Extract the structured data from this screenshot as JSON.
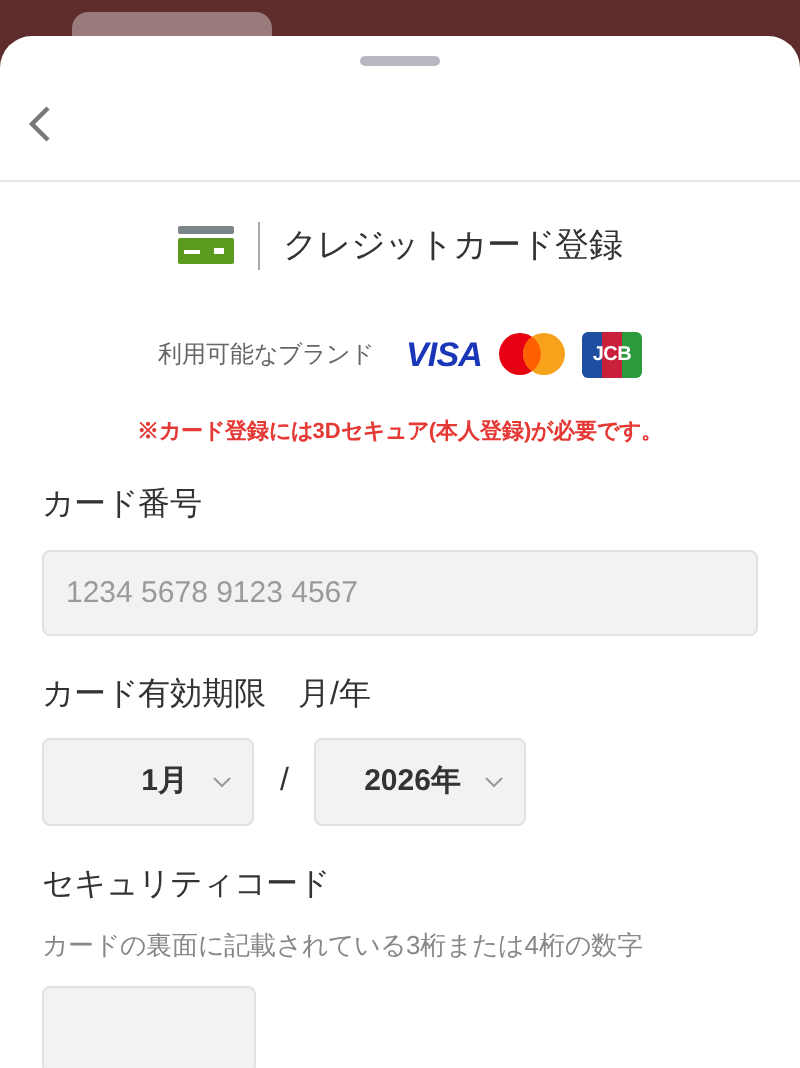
{
  "header": {
    "title": "クレジットカード登録"
  },
  "brands": {
    "label": "利用可能なブランド",
    "items": [
      {
        "kind": "visa",
        "text": "VISA"
      },
      {
        "kind": "mastercard"
      },
      {
        "kind": "jcb",
        "text": "JCB"
      }
    ]
  },
  "notice": "※カード登録には3Dセキュア(本人登録)が必要です。",
  "card_number": {
    "label": "カード番号",
    "placeholder": "1234 5678 9123 4567"
  },
  "expiry": {
    "label": "カード有効期限　月/年",
    "month": "1月",
    "separator": "/",
    "year": "2026年"
  },
  "security_code": {
    "label": "セキュリティコード",
    "hint": "カードの裏面に記載されている3桁または4桁の数字"
  }
}
